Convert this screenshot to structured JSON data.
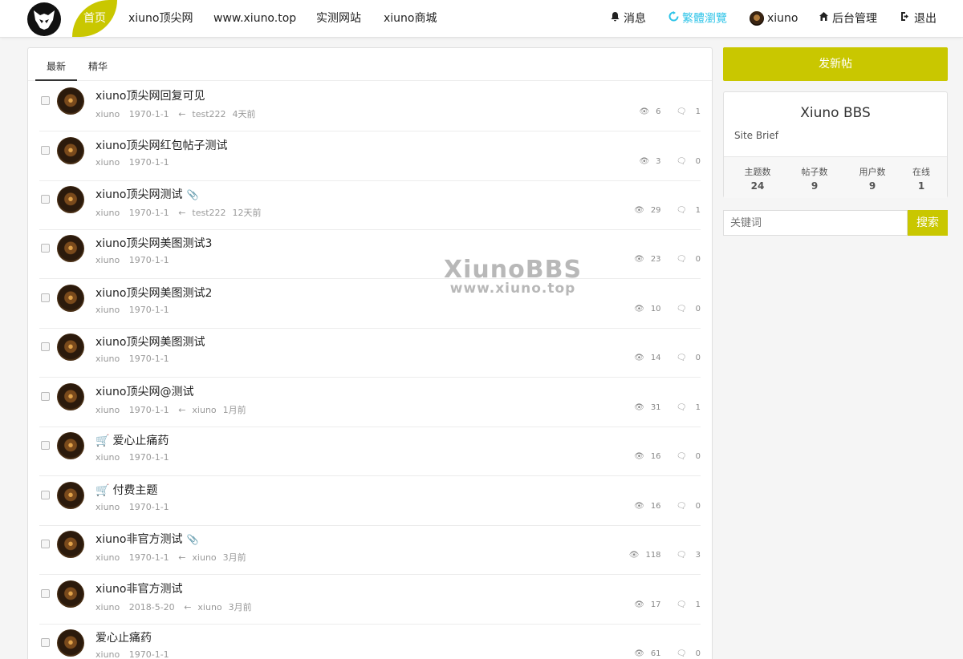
{
  "nav": {
    "home": "首页",
    "items": [
      "xiuno顶尖网",
      "www.xiuno.top",
      "实测网站",
      "xiuno商城"
    ],
    "messages": "消息",
    "trad": "繁體瀏覽",
    "user": "xiuno",
    "admin": "后台管理",
    "logout": "退出"
  },
  "tabs": [
    "最新",
    "精华"
  ],
  "threads": [
    {
      "title": "xiuno顶尖网回复可见",
      "author": "xiuno",
      "date": "1970-1-1",
      "last_user": "test222",
      "last_time": "4天前",
      "views": "6",
      "replies": "1",
      "attach": false,
      "paid": false
    },
    {
      "title": "xiuno顶尖网红包帖子测试",
      "author": "xiuno",
      "date": "1970-1-1",
      "last_user": "",
      "last_time": "",
      "views": "3",
      "replies": "0",
      "attach": false,
      "paid": false
    },
    {
      "title": "xiuno顶尖网测试",
      "author": "xiuno",
      "date": "1970-1-1",
      "last_user": "test222",
      "last_time": "12天前",
      "views": "29",
      "replies": "1",
      "attach": true,
      "paid": false
    },
    {
      "title": "xiuno顶尖网美图测试3",
      "author": "xiuno",
      "date": "1970-1-1",
      "last_user": "",
      "last_time": "",
      "views": "23",
      "replies": "0",
      "attach": false,
      "paid": false
    },
    {
      "title": "xiuno顶尖网美图测试2",
      "author": "xiuno",
      "date": "1970-1-1",
      "last_user": "",
      "last_time": "",
      "views": "10",
      "replies": "0",
      "attach": false,
      "paid": false
    },
    {
      "title": "xiuno顶尖网美图测试",
      "author": "xiuno",
      "date": "1970-1-1",
      "last_user": "",
      "last_time": "",
      "views": "14",
      "replies": "0",
      "attach": false,
      "paid": false
    },
    {
      "title": "xiuno顶尖网@测试",
      "author": "xiuno",
      "date": "1970-1-1",
      "last_user": "xiuno",
      "last_time": "1月前",
      "views": "31",
      "replies": "1",
      "attach": false,
      "paid": false
    },
    {
      "title": "爱心止痛药",
      "author": "xiuno",
      "date": "1970-1-1",
      "last_user": "",
      "last_time": "",
      "views": "16",
      "replies": "0",
      "attach": false,
      "paid": true
    },
    {
      "title": "付费主题",
      "author": "xiuno",
      "date": "1970-1-1",
      "last_user": "",
      "last_time": "",
      "views": "16",
      "replies": "0",
      "attach": false,
      "paid": true
    },
    {
      "title": "xiuno非官方测试",
      "author": "xiuno",
      "date": "1970-1-1",
      "last_user": "xiuno",
      "last_time": "3月前",
      "views": "118",
      "replies": "3",
      "attach": true,
      "paid": false
    },
    {
      "title": "xiuno非官方测试",
      "author": "xiuno",
      "date": "2018-5-20",
      "last_user": "xiuno",
      "last_time": "3月前",
      "views": "17",
      "replies": "1",
      "attach": false,
      "paid": false
    },
    {
      "title": "爱心止痛药",
      "author": "xiuno",
      "date": "1970-1-1",
      "last_user": "",
      "last_time": "",
      "views": "61",
      "replies": "0",
      "attach": false,
      "paid": false
    }
  ],
  "sidebar": {
    "post_button": "发新帖",
    "site_title": "Xiuno BBS",
    "site_brief": "Site Brief",
    "stats": [
      {
        "label": "主题数",
        "value": "24"
      },
      {
        "label": "帖子数",
        "value": "9"
      },
      {
        "label": "用户数",
        "value": "9"
      },
      {
        "label": "在线",
        "value": "1"
      }
    ],
    "search_placeholder": "关键词",
    "search_button": "搜索"
  },
  "watermark": {
    "line1": "XiunoBBS",
    "line2": "www.xiuno.top"
  },
  "colors": {
    "accent": "#c9c700",
    "cyan": "#2fc4e8"
  }
}
